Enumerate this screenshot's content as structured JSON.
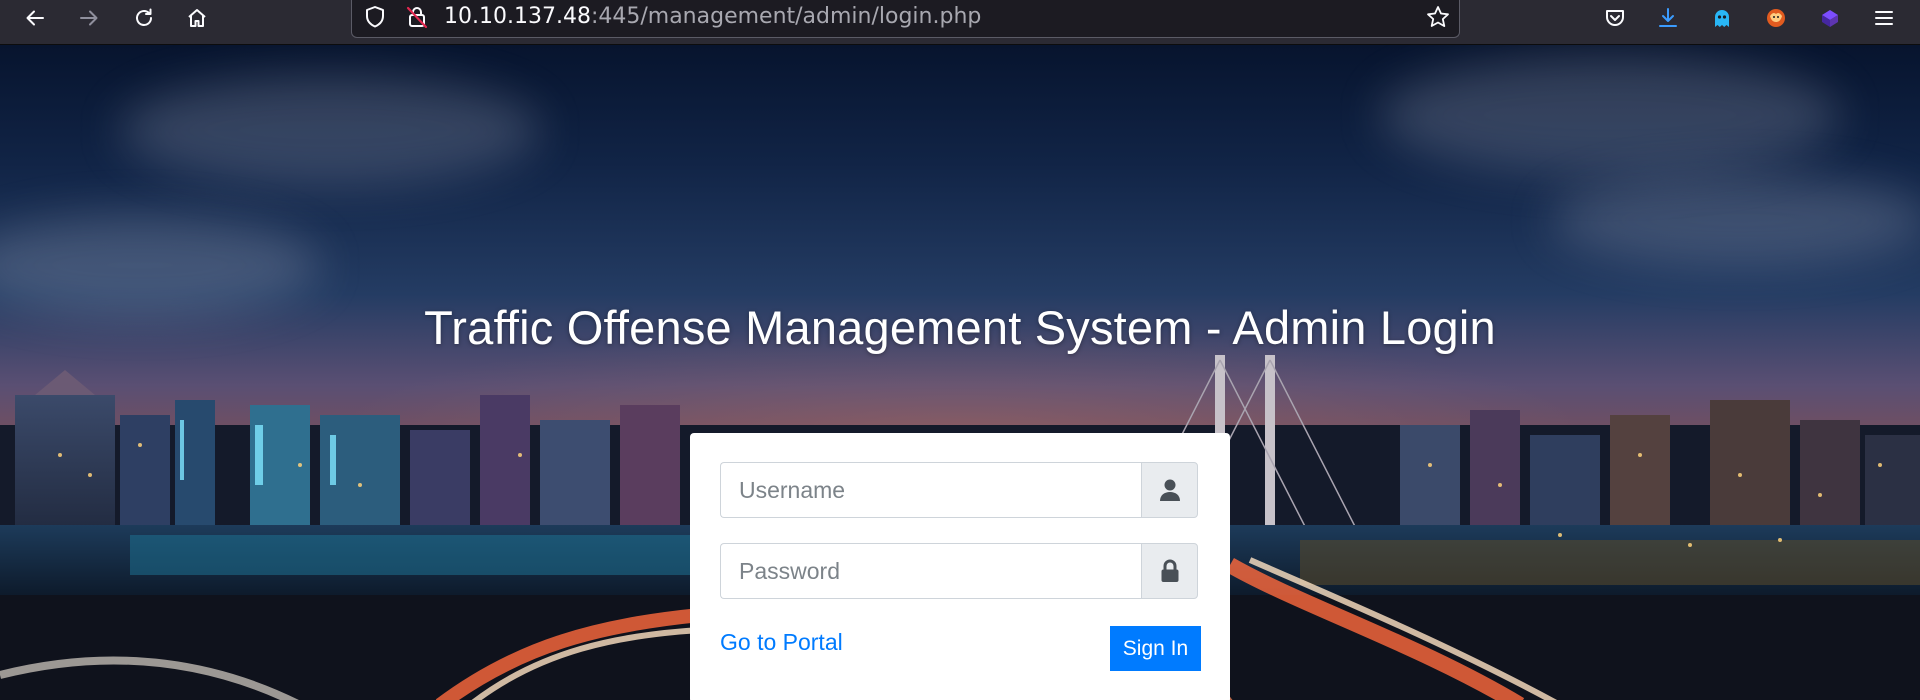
{
  "browser": {
    "url_host": "10.10.137.48",
    "url_rest": ":445/management/admin/login.php",
    "icons": {
      "back": "back-arrow-icon",
      "forward": "forward-arrow-icon",
      "reload": "reload-icon",
      "home": "home-icon",
      "tracking": "shield-icon",
      "connection": "insecure-lock-icon",
      "bookmark": "star-icon",
      "pocket": "pocket-icon",
      "downloads": "download-icon",
      "extensions": [
        "ghost-extension-icon",
        "fox-extension-icon",
        "purple-cube-extension-icon"
      ],
      "menu": "hamburger-menu-icon"
    }
  },
  "page": {
    "title": "Traffic Offense Management System - Admin Login",
    "form": {
      "username_placeholder": "Username",
      "password_placeholder": "Password",
      "portal_link": "Go to Portal",
      "signin_label": "Sign In"
    },
    "colors": {
      "accent": "#007bff",
      "card": "#ffffff"
    }
  }
}
